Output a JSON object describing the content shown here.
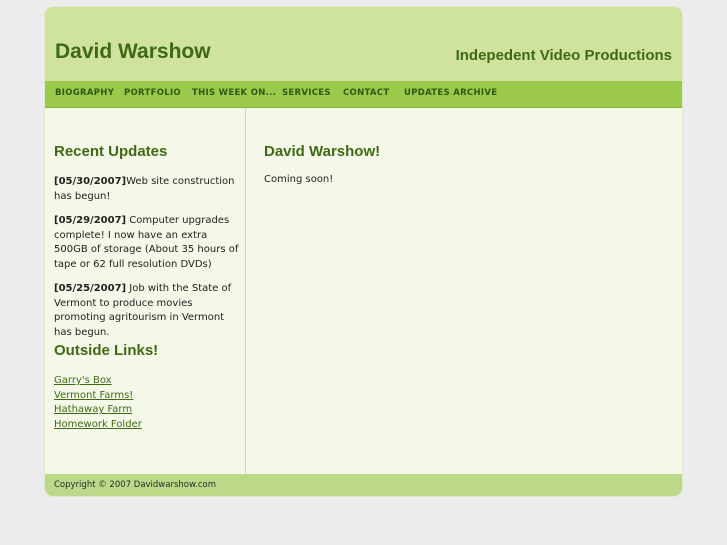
{
  "header": {
    "title": "David Warshow",
    "slogan": "Indepedent Video Productions"
  },
  "nav": {
    "items": [
      {
        "label": "BIOGRAPHY"
      },
      {
        "label": "PORTFOLIO"
      },
      {
        "label": "THIS WEEK ON..."
      },
      {
        "label": "SERVICES"
      },
      {
        "label": "CONTACT"
      },
      {
        "label": "UPDATES ARCHIVE"
      }
    ]
  },
  "sidebar": {
    "updates_heading": "Recent Updates",
    "updates": [
      {
        "date": "[05/30/2007]",
        "text": "Web site construction has begun!"
      },
      {
        "date": "[05/29/2007]",
        "text": " Computer upgrades complete! I now have an extra 500GB of storage (About 35 hours of tape or 62 full resolution DVDs)"
      },
      {
        "date": "[05/25/2007]",
        "text": " Job with the State of Vermont to produce movies promoting agritourism in Vermont has begun."
      }
    ],
    "links_heading": "Outside Links!",
    "links": [
      {
        "label": "Garry's Box"
      },
      {
        "label": "Vermont Farms!"
      },
      {
        "label": "Hathaway Farm"
      },
      {
        "label": "Homework Folder"
      }
    ]
  },
  "main": {
    "heading": "David Warshow!",
    "body": "Coming soon!"
  },
  "footer": {
    "copyright": "Copyright © 2007  Davidwarshow.com"
  }
}
